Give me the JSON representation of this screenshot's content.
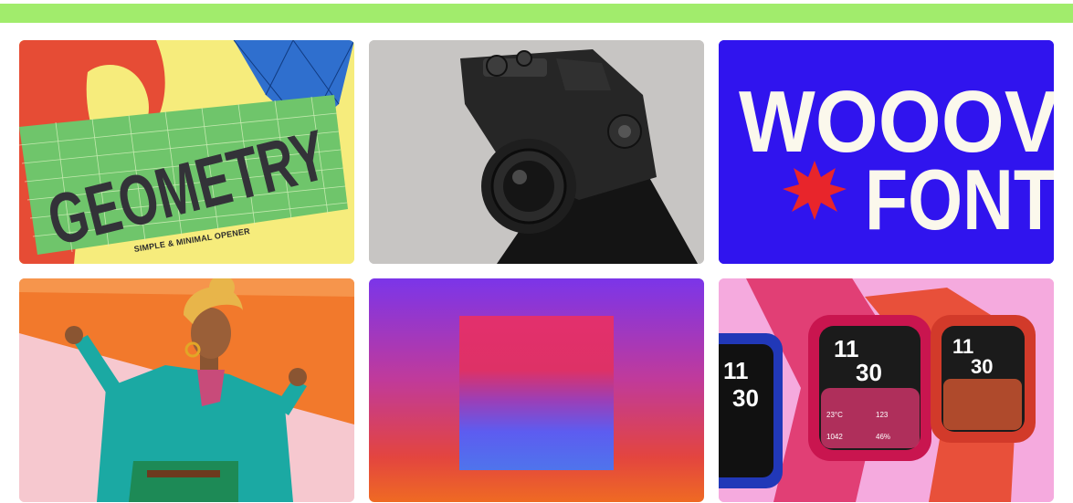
{
  "top_bar": {
    "color": "#a1ec6c"
  },
  "cards": [
    {
      "kind": "geometry-poster",
      "headline": "GEOMETRY",
      "caption": "SIMPLE & MINIMAL OPENER"
    },
    {
      "kind": "camera-photo"
    },
    {
      "kind": "font-poster",
      "line1": "WOOOV",
      "line2": "FONT"
    },
    {
      "kind": "portrait-photo"
    },
    {
      "kind": "gradient-art"
    },
    {
      "kind": "smartwatch-photo",
      "watch_hour": "11",
      "watch_minute": "30",
      "watch_stats": [
        "23°C",
        "123",
        "1042",
        "46%"
      ]
    }
  ]
}
